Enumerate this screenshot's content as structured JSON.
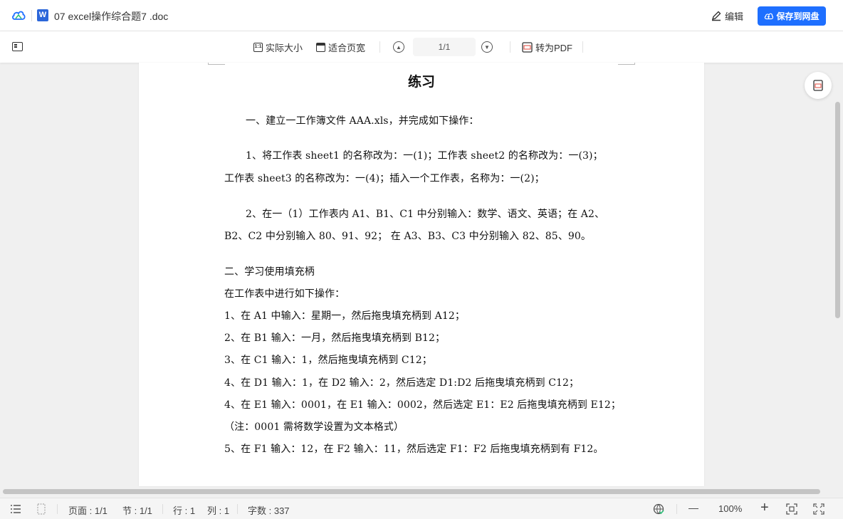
{
  "titlebar": {
    "doc_title": "07 excel操作综合题7 .doc",
    "edit_label": "编辑",
    "save_label": "保存到网盘",
    "accent": "#1e6fff"
  },
  "toolbar": {
    "actual_size": "实际大小",
    "fit_width": "适合页宽",
    "page_value": "1/1",
    "to_pdf": "转为PDF",
    "actual_size_icon": "1:1"
  },
  "document": {
    "heading": "练习",
    "lines": [
      "一、建立一工作簿文件 AAA.xls，并完成如下操作：",
      "1、将工作表 sheet1 的名称改为：一(1)；工作表 sheet2 的名称改为：一(3)；",
      "工作表 sheet3 的名称改为：一(4)；插入一个工作表，名称为：一(2)；",
      "2、在一（1）工作表内 A1、B1、C1 中分别输入：数学、语文、英语；在 A2、",
      "B2、C2 中分别输入 80、91、92；    在 A3、B3、C3 中分别输入 82、85、90。",
      "二、学习使用填充柄",
      "在工作表中进行如下操作：",
      "1、在 A1 中输入：星期一，然后拖曳填充柄到 A12；",
      "2、在 B1 输入：一月，然后拖曳填充柄到 B12；",
      "3、在 C1 输入：1，然后拖曳填充柄到 C12；",
      "4、在 D1 输入：1，在 D2 输入：2，然后选定 D1:D2 后拖曳填充柄到 C12；",
      "4、在 E1 输入：0001，在 E1 输入：0002，然后选定 E1：E2 后拖曳填充柄到 E12；",
      "（注：0001 需将数学设置为文本格式）",
      "5、在 F1 输入：12，在 F2 输入：11，然后选定 F1：F2 后拖曳填充柄到有 F12。"
    ]
  },
  "statusbar": {
    "page": "页面 : 1/1",
    "section": "节 : 1/1",
    "row": "行 : 1",
    "col": "列 : 1",
    "word_count": "字数 : 337",
    "zoom": "100%",
    "zoom_out": "—",
    "zoom_in": "+"
  }
}
